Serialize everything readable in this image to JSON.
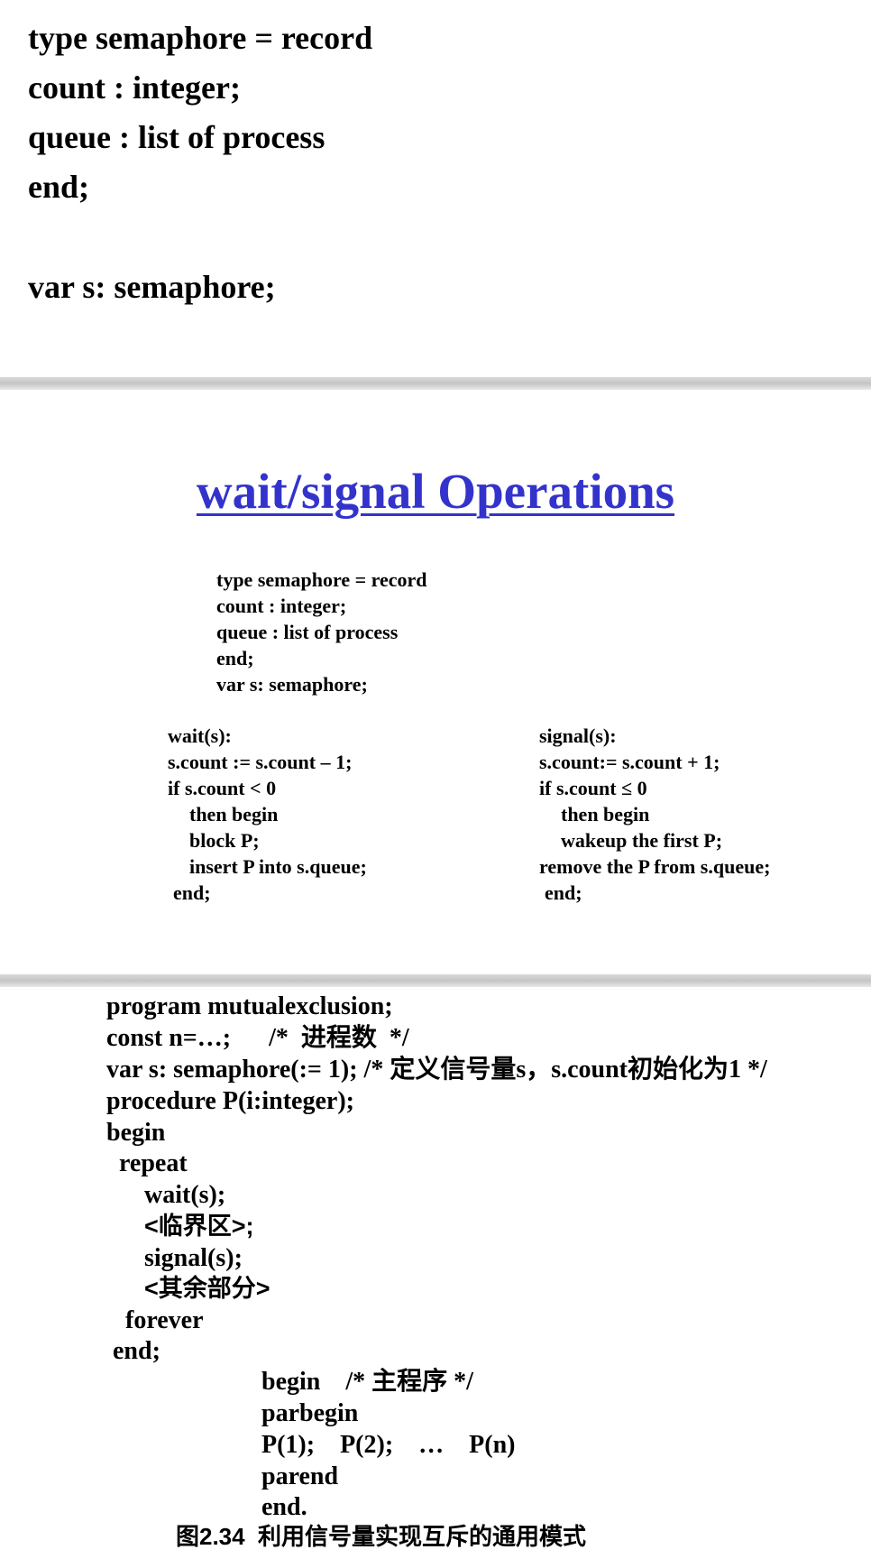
{
  "slide1": {
    "lines": [
      "type semaphore = record",
      "count : integer;",
      "queue : list of process",
      "end;",
      "var s: semaphore;"
    ]
  },
  "slide2": {
    "title": "wait/signal Operations",
    "type_block": [
      "type semaphore = record",
      "count : integer;",
      "queue : list of process",
      "end;",
      "var s: semaphore;"
    ],
    "wait_block": [
      "wait(s):",
      "s.count := s.count – 1;",
      "if s.count < 0",
      "then begin",
      "block P;",
      "insert P into s.queue;",
      "end;"
    ],
    "signal_block": [
      "signal(s):",
      "s.count:= s.count + 1;",
      "if s.count ≤ 0",
      "then begin",
      "wakeup the first P;",
      "remove the P from s.queue;",
      "end;"
    ]
  },
  "slide3": {
    "lines": [
      "program mutualexclusion;",
      "const n=…;      /*  进程数  */",
      "var s: semaphore(:= 1); /* 定义信号量s，s.count初始化为1 */",
      "procedure P(i:integer);",
      "begin",
      "repeat",
      "wait(s);",
      "<临界区>;",
      "signal(s);",
      "<其余部分>",
      "forever",
      "end;"
    ],
    "main_lines": [
      "begin    /* 主程序 */",
      "parbegin",
      "P(1);    P(2);    …    P(n)",
      "parend",
      "end."
    ],
    "caption": "图2.34  利用信号量实现互斥的通用模式"
  }
}
